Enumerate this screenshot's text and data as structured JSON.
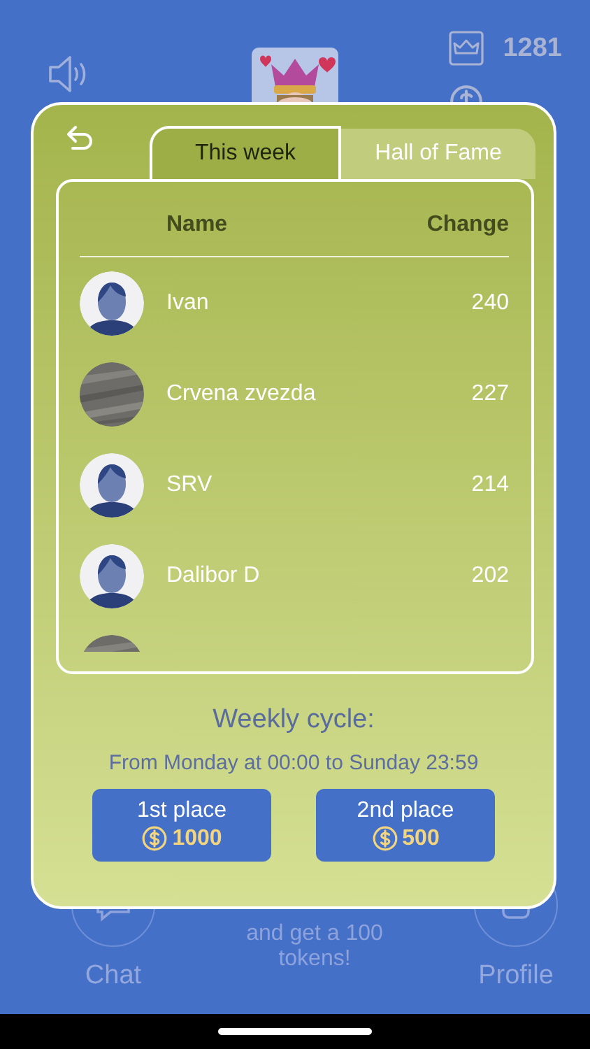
{
  "top_bar": {
    "stats": [
      {
        "kind": "crown",
        "value": "1281"
      },
      {
        "kind": "coins"
      }
    ]
  },
  "leaderboard": {
    "tabs": [
      {
        "label": "This week",
        "selected": true
      },
      {
        "label": "Hall of Fame",
        "selected": false
      }
    ],
    "columns": [
      "Name",
      "Change"
    ],
    "rows": [
      {
        "kind": "silhouette",
        "name": "Ivan",
        "change": "240"
      },
      {
        "kind": "picture",
        "name": "Crvena zvezda",
        "change": "227"
      },
      {
        "kind": "silhouette",
        "name": "SRV",
        "change": "214"
      },
      {
        "kind": "silhouette",
        "name": "Dalibor D",
        "change": "202"
      },
      {
        "kind": "picture"
      }
    ],
    "cycle_title": "Weekly cycle:",
    "cycle_text": "From Monday at 00:00 to Sunday 23:59",
    "prizes": [
      {
        "place": "1st place",
        "amount": "1000"
      },
      {
        "place": "2nd place",
        "amount": "500"
      }
    ]
  },
  "bottom_nav": {
    "items": [
      {
        "kind": "chat",
        "label": "Chat"
      },
      {
        "kind": "promo",
        "label": "and get a 100 tokens!"
      },
      {
        "kind": "profile",
        "label": "Profile"
      }
    ]
  }
}
